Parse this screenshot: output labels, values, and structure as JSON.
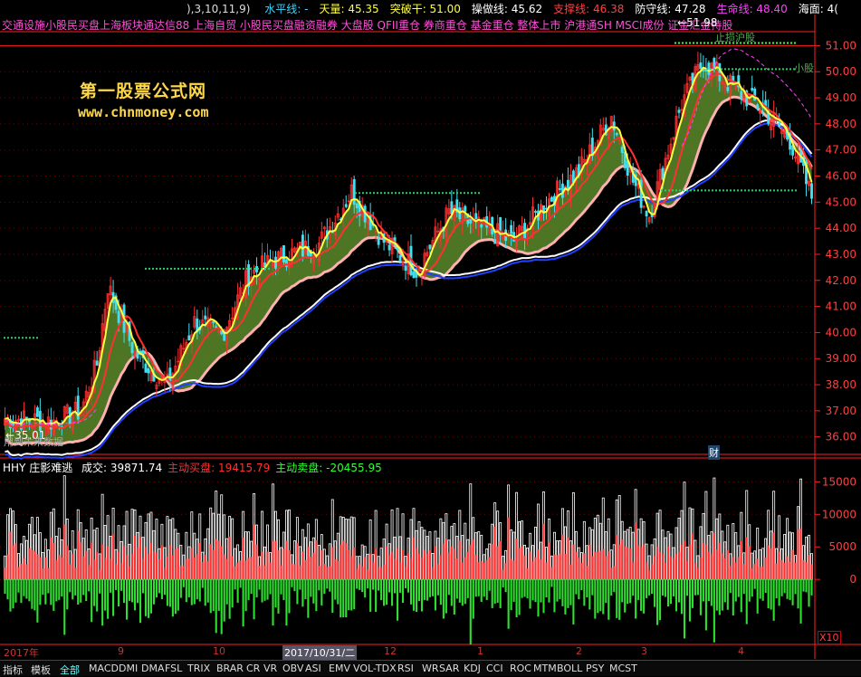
{
  "header": {
    "prefix": "),3,10,11,9)",
    "items": [
      {
        "label": "水平线:",
        "value": "-",
        "color": "#3ad4ff"
      },
      {
        "label": "天量:",
        "value": "45.35",
        "color": "#ffff40"
      },
      {
        "label": "突破干:",
        "value": "51.00",
        "color": "#ffff40"
      },
      {
        "label": "操做线:",
        "value": "45.62",
        "color": "#ffffff"
      },
      {
        "label": "支撑线:",
        "value": "46.38",
        "color": "#ff4040"
      },
      {
        "label": "防守线:",
        "value": "47.28",
        "color": "#ffffff"
      },
      {
        "label": "生命线:",
        "value": "48.40",
        "color": "#ff40ff"
      },
      {
        "label": "海面:",
        "value": "4(",
        "color": "#ffffff"
      }
    ]
  },
  "blocks_line": "交通设施小股民买盘上海板块通达信88 上海自贸 小股民买盘融资融券 大盘股 QFII重仓 券商重仓 基金重仓 整体上市 沪港通SH MSCI成份 证金汇金持股",
  "watermark": {
    "line1": "第一股票公式网",
    "line2": "www.chnmoney.com"
  },
  "annotations": {
    "high_label": "51.98",
    "low_label": "35.01",
    "no_future": "用到未来数据",
    "cai": "财",
    "xiao": "小股",
    "stop_mark": "止损沪股",
    "x10": "X10"
  },
  "volume_header": {
    "title": "HHY 庄影难逃",
    "items": [
      {
        "label": "成交:",
        "value": "39871.74",
        "color": "#ffffff"
      },
      {
        "label": "主动买盘:",
        "value": "19415.79",
        "color": "#ff3030"
      },
      {
        "label": "主动卖盘:",
        "value": "-20455.95",
        "color": "#30ff30"
      }
    ]
  },
  "dates": [
    "2017年",
    "9",
    "10",
    "2017/10/31/二",
    "12",
    "1",
    "2",
    "3",
    "4"
  ],
  "tabs": [
    "指标",
    "模板",
    "全部",
    "MACD",
    "DMI",
    "DMA",
    "FSL",
    "TRIX",
    "BRAR",
    "CR",
    "VR",
    "OBV",
    "ASI",
    "EMV",
    "VOL-TDX",
    "RSI",
    "WR",
    "SAR",
    "KDJ",
    "CCI",
    "ROC",
    "MTM",
    "BOLL",
    "PSY",
    "MCST"
  ],
  "colors": {
    "up": "#ff3030",
    "down": "#40e0f0",
    "ma_yellow": "#ffff40",
    "ma_red": "#ff3030",
    "ma_white": "#ffffff",
    "ma_blue": "#2040ff",
    "fill_green": "#5a8a2a",
    "fill_pink": "#ffb0b0",
    "axis": "#ff2020"
  },
  "chart_data": {
    "type": "candlestick",
    "price_axis": {
      "ticks": [
        36.0,
        37.0,
        38.0,
        39.0,
        40.0,
        41.0,
        42.0,
        43.0,
        44.0,
        45.0,
        46.0,
        47.0,
        48.0,
        49.0,
        50.0,
        51.0
      ],
      "min": 35.4,
      "max": 51.5
    },
    "volume_axis": {
      "ticks": [
        15000,
        10000,
        5000,
        0
      ],
      "min": -10000,
      "max": 17000
    },
    "levels": {
      "break": 51.0,
      "operate": 45.62,
      "support": 46.38,
      "defense": 47.28,
      "life": 48.4,
      "high": 51.98,
      "low": 35.01
    },
    "close_anchors": [
      [
        0,
        36.7
      ],
      [
        18,
        36.6
      ],
      [
        28,
        37.0
      ],
      [
        34,
        38.8
      ],
      [
        38,
        41.8
      ],
      [
        48,
        39.2
      ],
      [
        60,
        38.0
      ],
      [
        70,
        40.4
      ],
      [
        80,
        39.9
      ],
      [
        90,
        42.2
      ],
      [
        100,
        42.8
      ],
      [
        116,
        43.4
      ],
      [
        128,
        45.4
      ],
      [
        140,
        43.5
      ],
      [
        152,
        42.4
      ],
      [
        164,
        44.6
      ],
      [
        176,
        44.0
      ],
      [
        188,
        43.5
      ],
      [
        200,
        45.0
      ],
      [
        212,
        46.2
      ],
      [
        224,
        48.3
      ],
      [
        232,
        45.8
      ],
      [
        238,
        44.5
      ],
      [
        250,
        48.8
      ],
      [
        258,
        50.4
      ],
      [
        270,
        49.3
      ],
      [
        280,
        48.6
      ],
      [
        290,
        47.4
      ],
      [
        298,
        45.2
      ]
    ],
    "ma_offsets": {
      "yellow": 0.0,
      "red": -0.6,
      "pink": -1.4,
      "white": -2.3
    }
  }
}
